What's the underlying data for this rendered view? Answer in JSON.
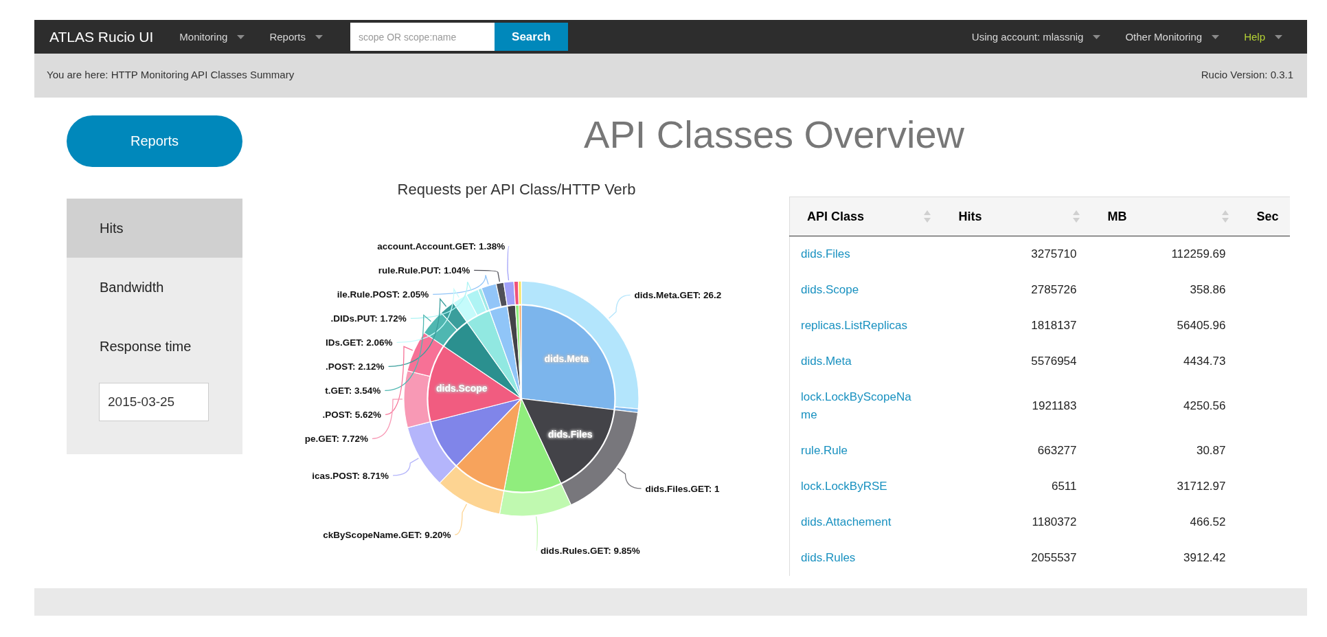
{
  "navbar": {
    "brand": "ATLAS Rucio UI",
    "menus": [
      {
        "label": "Monitoring"
      },
      {
        "label": "Reports"
      }
    ],
    "search": {
      "placeholder": "scope OR scope:name",
      "button": "Search"
    },
    "right_menus": [
      {
        "label": "Using account: mlassnig",
        "kind": "plain"
      },
      {
        "label": "Other Monitoring",
        "kind": "plain"
      },
      {
        "label": "Help",
        "kind": "help"
      }
    ]
  },
  "breadcrumb": {
    "text": "You are here: HTTP Monitoring API Classes Summary",
    "version": "Rucio Version: 0.3.1"
  },
  "sidebar": {
    "button": "Reports",
    "items": [
      {
        "label": "Hits",
        "selected": true
      },
      {
        "label": "Bandwidth",
        "selected": false
      },
      {
        "label": "Response time",
        "selected": false
      }
    ],
    "date": "2015-03-25"
  },
  "title": "API Classes Overview",
  "chart": {
    "title": "Requests per API Class/HTTP Verb",
    "outer_labels": [
      "account.Account.GET: 1.38%",
      "rule.Rule.PUT: 1.04%",
      "ile.Rule.POST: 2.05%",
      "dids.Meta.GET: 26.2",
      ".DIDs.PUT: 1.72%",
      "IDs.GET: 2.06%",
      ".POST: 2.12%",
      "t.GET: 3.54%",
      ".POST: 5.62%",
      "pe.GET: 7.72%",
      "icas.POST: 8.71%",
      "dids.Files.GET: 1",
      "ckByScopeName.GET: 9.20%",
      "dids.Rules.GET: 9.85%"
    ],
    "inner_labels": [
      "dids.Meta",
      "dids.Files",
      "dids.Scope"
    ]
  },
  "table": {
    "columns": [
      "API Class",
      "Hits",
      "MB",
      "Sec"
    ],
    "rows": [
      {
        "api_class": "dids.Files",
        "hits": "3275710",
        "mb": "112259.69"
      },
      {
        "api_class": "dids.Scope",
        "hits": "2785726",
        "mb": "358.86"
      },
      {
        "api_class": "replicas.ListReplicas",
        "hits": "1818137",
        "mb": "56405.96"
      },
      {
        "api_class": "dids.Meta",
        "hits": "5576954",
        "mb": "4434.73"
      },
      {
        "api_class": "lock.LockByScopeName",
        "hits": "1921183",
        "mb": "4250.56"
      },
      {
        "api_class": "rule.Rule",
        "hits": "663277",
        "mb": "30.87"
      },
      {
        "api_class": "lock.LockByRSE",
        "hits": "6511",
        "mb": "31712.97"
      },
      {
        "api_class": "dids.Attachement",
        "hits": "1180372",
        "mb": "466.52"
      },
      {
        "api_class": "dids.Rules",
        "hits": "2055537",
        "mb": "3912.42"
      }
    ]
  }
}
